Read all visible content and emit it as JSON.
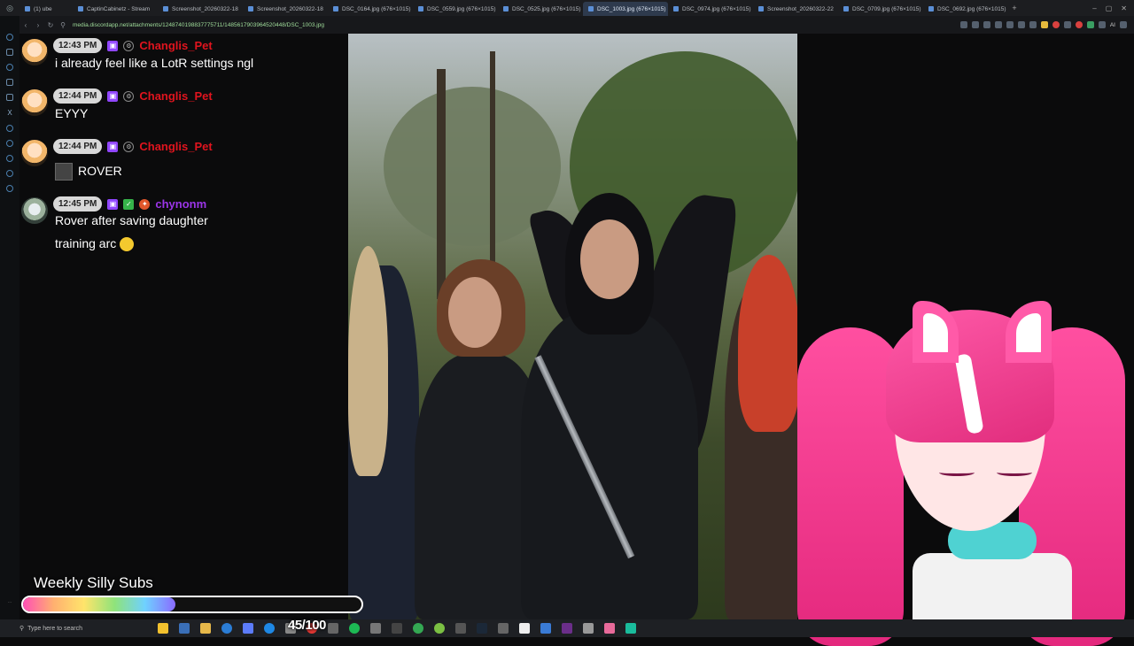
{
  "browser": {
    "tabs": [
      {
        "label": "(1) ube",
        "active": false
      },
      {
        "label": "CaptinCabinetz - Stream",
        "active": false
      },
      {
        "label": "Screenshot_20260322-18",
        "active": false
      },
      {
        "label": "Screenshot_20260322-18",
        "active": false
      },
      {
        "label": "DSC_0164.jpg (676×1015)",
        "active": false
      },
      {
        "label": "DSC_0559.jpg (676×1015)",
        "active": false
      },
      {
        "label": "DSC_0525.jpg (676×1015)",
        "active": false
      },
      {
        "label": "DSC_1003.jpg (676×1015)",
        "active": true
      },
      {
        "label": "DSC_0974.jpg (676×1015)",
        "active": false
      },
      {
        "label": "Screenshot_20260322-22",
        "active": false
      },
      {
        "label": "DSC_0709.jpg (676×1015)",
        "active": false
      },
      {
        "label": "DSC_0692.jpg (676×1015)",
        "active": false
      }
    ],
    "url": "media.discordapp.net/attachments/1248740198837775711/1485617903964520448/DSC_1003.jpg",
    "ai_label": "AI"
  },
  "chat": {
    "messages": [
      {
        "time": "12:43 PM",
        "user": "Changlis_Pet",
        "color": "#e0141e",
        "text": "i already feel like a LotR settings ngl"
      },
      {
        "time": "12:44 PM",
        "user": "Changlis_Pet",
        "color": "#e0141e",
        "text": "EYYY"
      },
      {
        "time": "12:44 PM",
        "user": "Changlis_Pet",
        "color": "#e0141e",
        "text": "ROVER"
      },
      {
        "time": "12:45 PM",
        "user": "chynonm",
        "color": "#9b35e8",
        "text_line1": "Rover after saving daughter",
        "text_line2": "training arc"
      }
    ]
  },
  "goal": {
    "title": "Weekly Silly Subs",
    "current": 45,
    "target": 100,
    "display": "45/100",
    "progress_fraction": 0.45
  },
  "taskbar": {
    "search_placeholder": "Type here to search"
  },
  "icons": {
    "search": "search-icon",
    "twitch_badge": "twitch-badge-icon",
    "mod_badge": "moderator-badge-icon"
  }
}
